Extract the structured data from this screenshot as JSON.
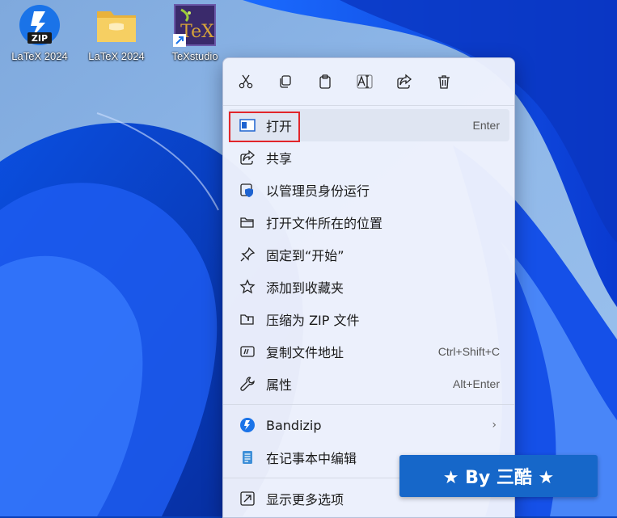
{
  "desktop": {
    "icons": [
      {
        "label": "LaTeX 2024",
        "icon": "bandizip-archive-icon"
      },
      {
        "label": "LaTeX 2024",
        "icon": "folder-icon"
      },
      {
        "label": "TeXstudio",
        "icon": "texstudio-shortcut-icon"
      }
    ],
    "zip_badge": "ZIP",
    "tex_logo": "TeX"
  },
  "context_menu": {
    "quick_actions": [
      {
        "name": "cut",
        "icon": "scissors-icon"
      },
      {
        "name": "copy",
        "icon": "copy-icon"
      },
      {
        "name": "paste",
        "icon": "clipboard-icon"
      },
      {
        "name": "rename",
        "icon": "rename-icon"
      },
      {
        "name": "share",
        "icon": "share-icon"
      },
      {
        "name": "delete",
        "icon": "trash-icon"
      }
    ],
    "items": [
      {
        "label": "打开",
        "shortcut": "Enter",
        "icon": "open-window-icon"
      },
      {
        "label": "共享",
        "shortcut": "",
        "icon": "share-icon"
      },
      {
        "label": "以管理员身份运行",
        "shortcut": "",
        "icon": "shield-icon"
      },
      {
        "label": "打开文件所在的位置",
        "shortcut": "",
        "icon": "folder-open-icon"
      },
      {
        "label": "固定到“开始”",
        "shortcut": "",
        "icon": "pin-icon"
      },
      {
        "label": "添加到收藏夹",
        "shortcut": "",
        "icon": "star-icon"
      },
      {
        "label": "压缩为 ZIP 文件",
        "shortcut": "",
        "icon": "zip-folder-icon"
      },
      {
        "label": "复制文件地址",
        "shortcut": "Ctrl+Shift+C",
        "icon": "copy-path-icon"
      },
      {
        "label": "属性",
        "shortcut": "Alt+Enter",
        "icon": "wrench-icon"
      }
    ],
    "extra_items": [
      {
        "label": "Bandizip",
        "icon": "bandizip-icon",
        "has_submenu": true
      },
      {
        "label": "在记事本中编辑",
        "icon": "notepad-icon"
      }
    ],
    "more_options": {
      "label": "显示更多选项",
      "icon": "more-options-icon"
    },
    "accent_color": "#1667c9",
    "highlight_color": "#e2262b"
  },
  "watermark": {
    "text": "★ By 三酷 ★"
  }
}
